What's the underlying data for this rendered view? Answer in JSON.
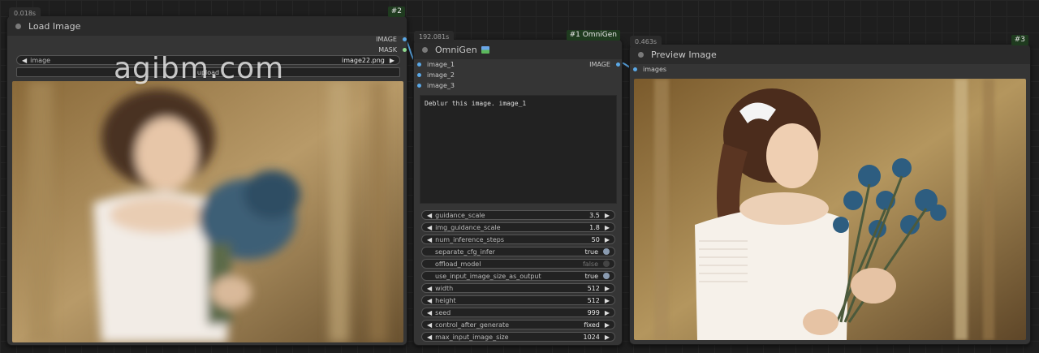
{
  "watermark": "agibm.com",
  "load_image": {
    "timer": "0.018s",
    "badge": "#2",
    "title": "Load Image",
    "outputs": [
      "IMAGE",
      "MASK"
    ],
    "image_widget": {
      "label": "image",
      "value": "image22.png"
    },
    "upload_label": "upload"
  },
  "omnigen": {
    "timer": "192.081s",
    "badge": "#1 OmniGen",
    "title": "OmniGen",
    "inputs": [
      "image_1",
      "image_2",
      "image_3"
    ],
    "output": "IMAGE",
    "prompt": "Deblur this image. image_1",
    "widgets": [
      {
        "label": "guidance_scale",
        "value": "3.5",
        "kind": "number"
      },
      {
        "label": "img_guidance_scale",
        "value": "1.8",
        "kind": "number"
      },
      {
        "label": "num_inference_steps",
        "value": "50",
        "kind": "number"
      },
      {
        "label": "separate_cfg_infer",
        "value": "true",
        "kind": "toggle"
      },
      {
        "label": "offload_model",
        "value": "false",
        "kind": "toggle"
      },
      {
        "label": "use_input_image_size_as_output",
        "value": "true",
        "kind": "toggle"
      },
      {
        "label": "width",
        "value": "512",
        "kind": "number"
      },
      {
        "label": "height",
        "value": "512",
        "kind": "number"
      },
      {
        "label": "seed",
        "value": "999",
        "kind": "number"
      },
      {
        "label": "control_after_generate",
        "value": "fixed",
        "kind": "number"
      },
      {
        "label": "max_input_image_size",
        "value": "1024",
        "kind": "number"
      }
    ]
  },
  "preview": {
    "timer": "0.463s",
    "badge": "#3",
    "title": "Preview Image",
    "input": "images"
  },
  "colors": {
    "link": "#5ba8e6",
    "badge_bg": "#1f3b1f"
  }
}
